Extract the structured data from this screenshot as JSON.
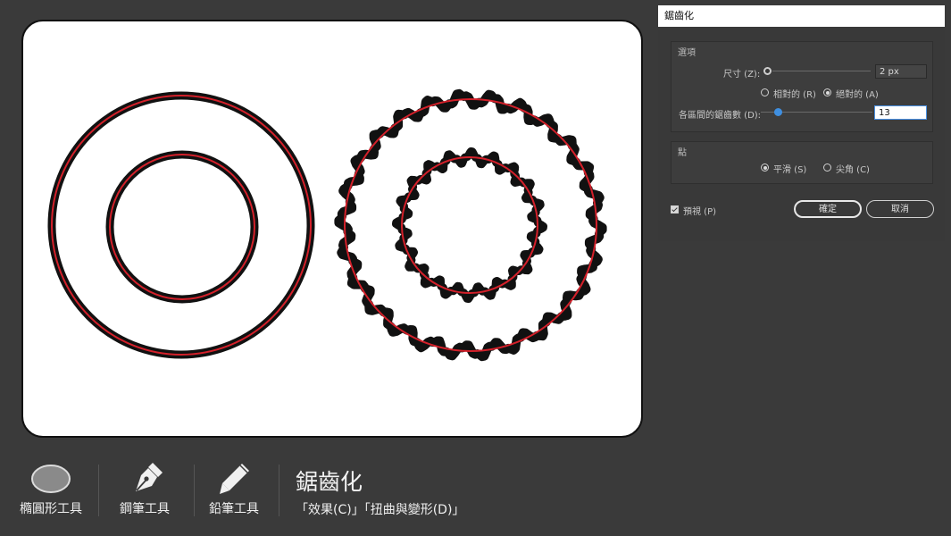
{
  "dialog": {
    "title": "鋸齒化",
    "options_group_title": "選項",
    "size_label": "尺寸 (Z):",
    "size_value": "2 px",
    "relative_label": "相對的 (R)",
    "absolute_label": "絕對的 (A)",
    "mode_selected": "absolute",
    "ridges_label": "各區間的鋸齒數 (D):",
    "ridges_value": "13",
    "points_group_title": "點",
    "smooth_label": "平滑 (S)",
    "corner_label": "尖角 (C)",
    "points_selected": "smooth",
    "preview_label": "預視 (P)",
    "preview_checked": true,
    "ok_label": "確定",
    "cancel_label": "取消"
  },
  "toolbar": {
    "ellipse_tool_label": "橢圓形工具",
    "pen_tool_label": "鋼筆工具",
    "pencil_tool_label": "鉛筆工具"
  },
  "effect": {
    "title": "鋸齒化",
    "path": "「效果(C)」「扭曲與變形(D)」"
  },
  "colors": {
    "background": "#3a3a3a",
    "stroke_black": "#111111",
    "stroke_red": "#d3202a",
    "accent_blue": "#3f8fe0"
  }
}
